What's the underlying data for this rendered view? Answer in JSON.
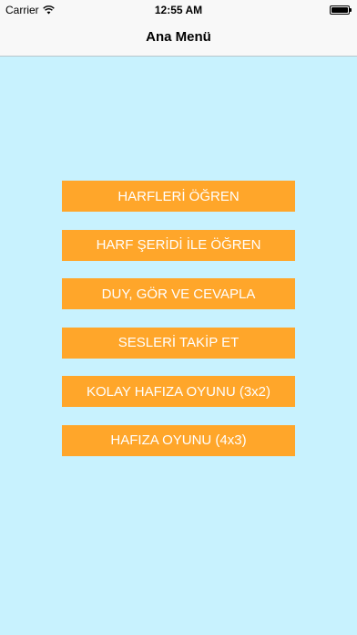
{
  "status_bar": {
    "carrier": "Carrier",
    "time": "12:55 AM",
    "wifi_icon": "wifi-icon",
    "battery_icon": "battery-icon",
    "battery_level": 1.0
  },
  "nav": {
    "title": "Ana Menü"
  },
  "colors": {
    "background": "#c8f2fe",
    "button": "#ffa62a",
    "button_text": "#ffffff"
  },
  "menu": {
    "items": [
      {
        "label": "HARFLERİ ÖĞREN"
      },
      {
        "label": "HARF ŞERİDİ İLE ÖĞREN"
      },
      {
        "label": "DUY, GÖR VE CEVAPLA"
      },
      {
        "label": "SESLERİ TAKİP ET"
      },
      {
        "label": "KOLAY HAFIZA OYUNU (3x2)"
      },
      {
        "label": "HAFIZA OYUNU (4x3)"
      }
    ]
  }
}
